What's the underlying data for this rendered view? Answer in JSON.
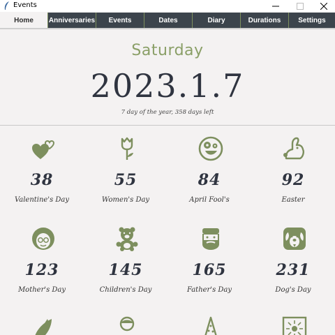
{
  "window": {
    "title": "Events"
  },
  "tabs": [
    {
      "label": "Home",
      "active": true
    },
    {
      "label": "Anniversaries",
      "active": false
    },
    {
      "label": "Events",
      "active": false
    },
    {
      "label": "Dates",
      "active": false
    },
    {
      "label": "Diary",
      "active": false
    },
    {
      "label": "Durations",
      "active": false
    },
    {
      "label": "Settings",
      "active": false
    }
  ],
  "header": {
    "weekday": "Saturday",
    "date": "2023.1.7",
    "year_info": "7 day of the year, 358 days left"
  },
  "events": [
    {
      "count": "38",
      "name": "Valentine's Day",
      "icon": "hearts-icon"
    },
    {
      "count": "55",
      "name": "Women's Day",
      "icon": "tulip-icon"
    },
    {
      "count": "84",
      "name": "April Fool's",
      "icon": "silly-face-icon"
    },
    {
      "count": "92",
      "name": "Easter",
      "icon": "rabbit-icon"
    },
    {
      "count": "123",
      "name": "Mother's Day",
      "icon": "grandma-icon"
    },
    {
      "count": "145",
      "name": "Children's Day",
      "icon": "teddy-bear-icon"
    },
    {
      "count": "165",
      "name": "Father's Day",
      "icon": "bearded-man-icon"
    },
    {
      "count": "231",
      "name": "Dog's Day",
      "icon": "dog-icon"
    },
    {
      "count": "",
      "name": "",
      "icon": "leaf-icon"
    },
    {
      "count": "",
      "name": "",
      "icon": "person-icon"
    },
    {
      "count": "",
      "name": "",
      "icon": "christmas-tree-icon"
    },
    {
      "count": "",
      "name": "",
      "icon": "firework-icon"
    }
  ],
  "colors": {
    "accent": "#7d8f5e",
    "tab_bg": "#3c444c",
    "background": "#f4f2f2",
    "text_dark": "#2f3440"
  }
}
